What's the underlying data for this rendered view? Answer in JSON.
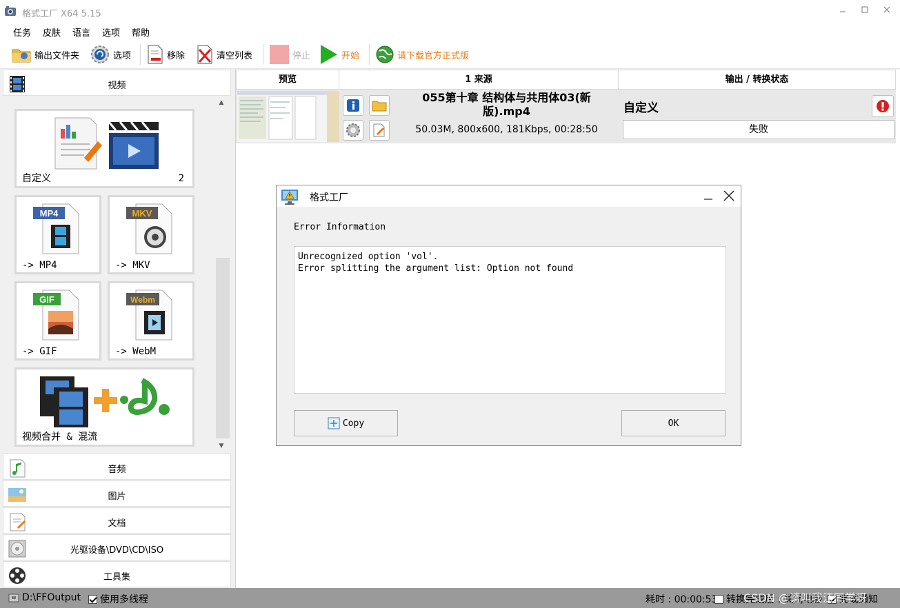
{
  "window": {
    "title": "格式工厂 X64 5.15"
  },
  "menu": [
    "任务",
    "皮肤",
    "语言",
    "选项",
    "帮助"
  ],
  "toolbar": {
    "output_folder": "输出文件夹",
    "options": "选项",
    "remove": "移除",
    "clear_list": "清空列表",
    "stop": "停止",
    "start": "开始",
    "download_official": "请下载官方正式版"
  },
  "sidebar": {
    "video_category": "视频",
    "tiles": {
      "custom": {
        "label": "自定义",
        "count": "2"
      },
      "mp4": {
        "badge": "MP4",
        "label": "-> MP4"
      },
      "mkv": {
        "badge": "MKV",
        "label": "-> MKV"
      },
      "gif": {
        "badge": "GIF",
        "label": "-> GIF"
      },
      "webm": {
        "badge": "Webm",
        "label": "-> WebM"
      },
      "merge": {
        "label": "视频合并 & 混流"
      }
    },
    "categories": [
      "音频",
      "图片",
      "文档",
      "光驱设备\\DVD\\CD\\ISO",
      "工具集"
    ]
  },
  "task_list": {
    "columns": [
      "预览",
      "1 来源",
      "输出 / 转换状态"
    ],
    "rows": [
      {
        "file_name": "055第十章 结构体与共用体03(新版).mp4",
        "file_info": "50.03M, 800x600, 181Kbps, 00:28:50",
        "output_format": "自定义",
        "status": "失败"
      }
    ]
  },
  "dialog": {
    "title": "格式工厂",
    "heading": "Error Information",
    "message_lines": [
      "Unrecognized option 'vol'.",
      "Error splitting the argument list: Option not found"
    ],
    "copy_button": "Copy",
    "ok_button": "OK"
  },
  "statusbar": {
    "output_path": "D:\\FFOutput",
    "multithread": "使用多线程",
    "elapsed": "耗时 : 00:00:53",
    "after_convert": "转换完成后 : 关闭电脑",
    "notify": "完成通知",
    "watermark": "CSDN @请叫我江同学呀"
  },
  "colors": {
    "accent_orange": "#e87a10",
    "fail_red": "#d42020",
    "status_bar": "#9a9a9a"
  }
}
